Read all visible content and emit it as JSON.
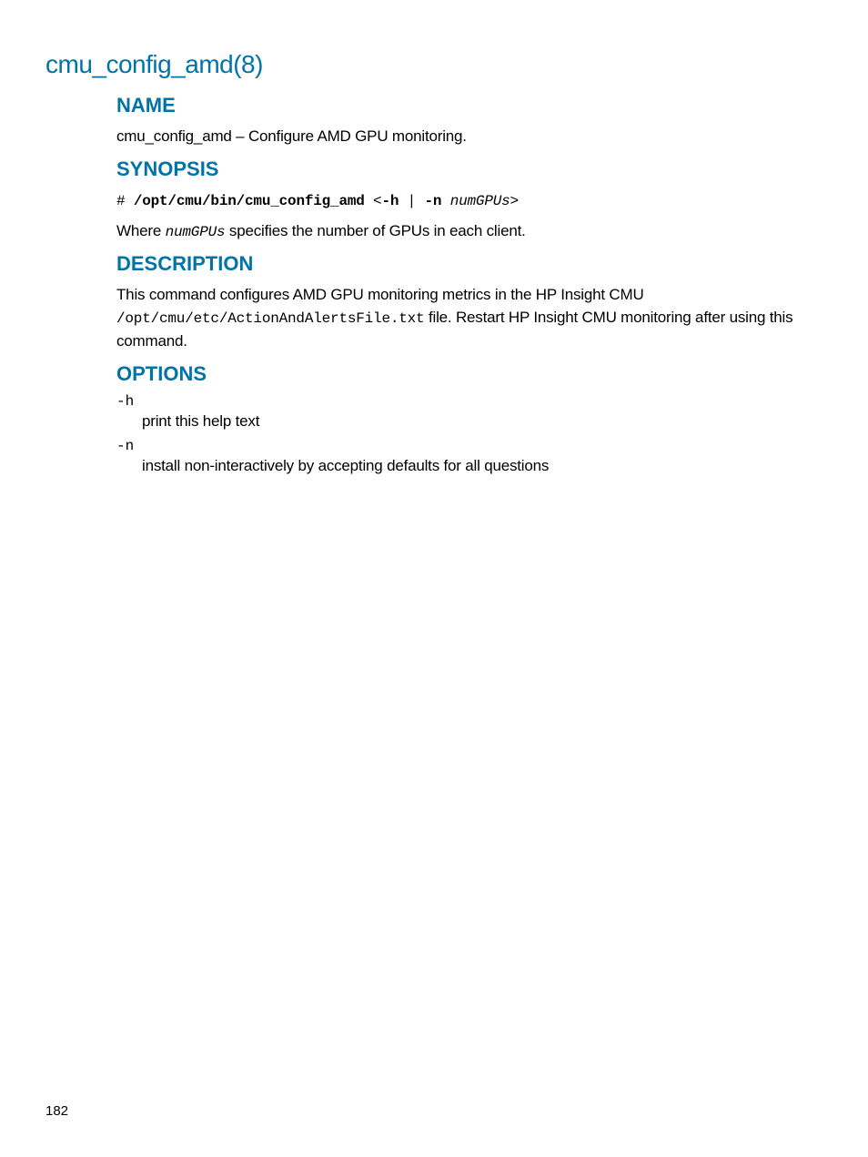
{
  "page_title": "cmu_config_amd(8)",
  "sections": {
    "name": {
      "heading": "NAME",
      "text": "cmu_config_amd – Configure AMD GPU monitoring."
    },
    "synopsis": {
      "heading": "SYNOPSIS",
      "prompt": "# ",
      "command": "/opt/cmu/bin/cmu_config_amd",
      "args_prefix": " <",
      "flag_h": "-h",
      "pipe": " | ",
      "flag_n": "-n",
      "space": " ",
      "param": "numGPUs",
      "args_suffix": ">",
      "where_prefix": "Where ",
      "where_param": "numGPUs",
      "where_suffix": " specifies the number of GPUs in each client."
    },
    "description": {
      "heading": "DESCRIPTION",
      "text_1": "This command configures AMD GPU monitoring metrics in the HP Insight CMU ",
      "path": "/opt/cmu/etc/ActionAndAlertsFile.txt",
      "text_2": " file. Restart HP Insight CMU monitoring after using this command."
    },
    "options": {
      "heading": "OPTIONS",
      "items": [
        {
          "flag": "-h",
          "desc": "print this help text"
        },
        {
          "flag": "-n",
          "desc": "install non-interactively by accepting defaults for all questions"
        }
      ]
    }
  },
  "page_number": "182"
}
